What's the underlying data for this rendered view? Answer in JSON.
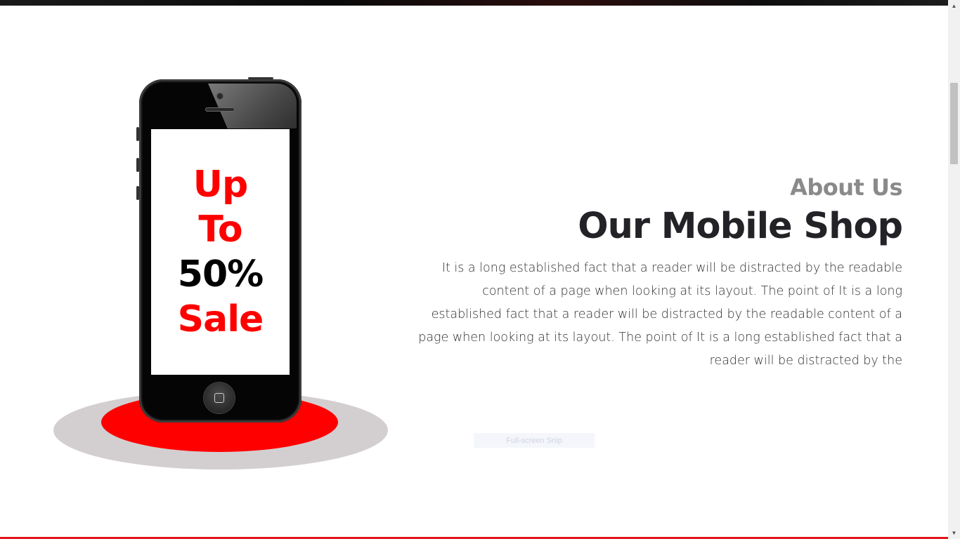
{
  "promo": {
    "line1": "Up",
    "line2": "To",
    "line3": "50%",
    "line4": "Sale"
  },
  "about": {
    "label": "About Us",
    "title": "Our Mobile Shop",
    "text": "It is a long established fact that a reader will be distracted by the readable content of a page when looking at its layout. The point of It is a long established fact that a reader will be distracted by the readable content of a page when looking at its layout. The point of It is a long established fact that a reader will be distracted by the"
  },
  "overlay": {
    "snip_label": "Full-screen Snip"
  },
  "colors": {
    "accent_red": "#ff0000",
    "bottom_line": "#e2161c",
    "heading_dark": "#232327",
    "label_gray": "#8a8a8a",
    "platform_gray": "#d3cfd0"
  }
}
